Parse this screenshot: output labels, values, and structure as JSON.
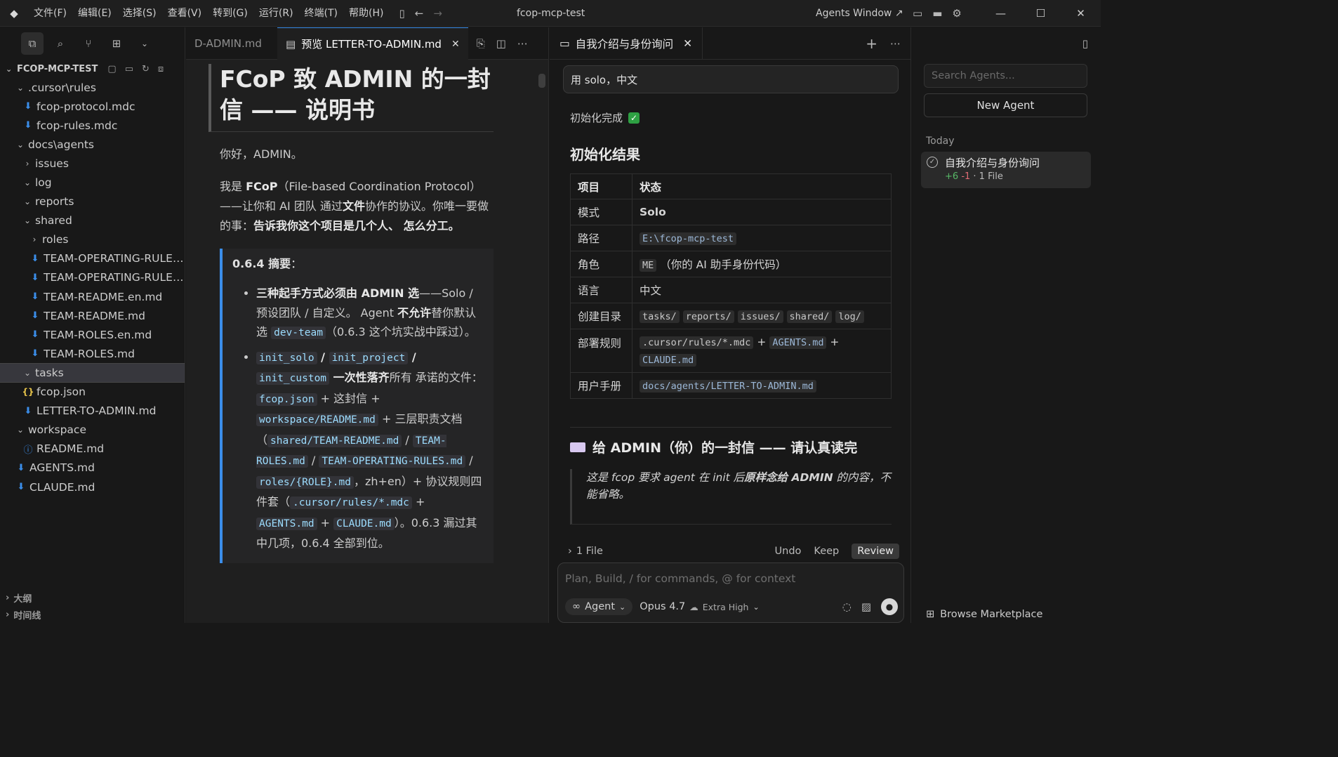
{
  "titlebar": {
    "menu": [
      "文件(F)",
      "编辑(E)",
      "选择(S)",
      "查看(V)",
      "转到(G)",
      "运行(R)",
      "终端(T)",
      "帮助(H)"
    ],
    "window_title": "fcop-mcp-test",
    "agents_window": "Agents Window ↗"
  },
  "sidebar": {
    "root": "FCOP-MCP-TEST",
    "tree": [
      {
        "label": ".cursor\\rules",
        "depth": 0,
        "kind": "folder-open"
      },
      {
        "label": "fcop-protocol.mdc",
        "depth": 1,
        "kind": "md"
      },
      {
        "label": "fcop-rules.mdc",
        "depth": 1,
        "kind": "md"
      },
      {
        "label": "docs\\agents",
        "depth": 0,
        "kind": "folder-open"
      },
      {
        "label": "issues",
        "depth": 1,
        "kind": "folder"
      },
      {
        "label": "log",
        "depth": 1,
        "kind": "folder-open"
      },
      {
        "label": "reports",
        "depth": 1,
        "kind": "folder-open"
      },
      {
        "label": "shared",
        "depth": 1,
        "kind": "folder-open"
      },
      {
        "label": "roles",
        "depth": 2,
        "kind": "folder"
      },
      {
        "label": "TEAM-OPERATING-RULES.en.md",
        "depth": 2,
        "kind": "md"
      },
      {
        "label": "TEAM-OPERATING-RULES.md",
        "depth": 2,
        "kind": "md"
      },
      {
        "label": "TEAM-README.en.md",
        "depth": 2,
        "kind": "md"
      },
      {
        "label": "TEAM-README.md",
        "depth": 2,
        "kind": "md"
      },
      {
        "label": "TEAM-ROLES.en.md",
        "depth": 2,
        "kind": "md"
      },
      {
        "label": "TEAM-ROLES.md",
        "depth": 2,
        "kind": "md"
      },
      {
        "label": "tasks",
        "depth": 1,
        "kind": "folder-open",
        "selected": true
      },
      {
        "label": "fcop.json",
        "depth": 1,
        "kind": "json"
      },
      {
        "label": "LETTER-TO-ADMIN.md",
        "depth": 1,
        "kind": "md"
      },
      {
        "label": "workspace",
        "depth": 0,
        "kind": "folder-open"
      },
      {
        "label": "README.md",
        "depth": 1,
        "kind": "info"
      },
      {
        "label": "AGENTS.md",
        "depth": 0,
        "kind": "md"
      },
      {
        "label": "CLAUDE.md",
        "depth": 0,
        "kind": "md"
      }
    ],
    "outline": "大纲",
    "timeline": "时间线"
  },
  "editor": {
    "tab_inactive": "D-ADMIN.md",
    "tab_active": "预览 LETTER-TO-ADMIN.md",
    "h1": "FCoP 致 ADMIN 的一封信 —— 说明书",
    "p1": "你好，ADMIN。",
    "p2_a": "我是 ",
    "p2_b": "FCoP",
    "p2_c": "（File-based Coordination Protocol）——让你和 AI 团队 通过",
    "p2_d": "文件",
    "p2_e": "协作的协议。你唯一要做的事：",
    "p2_f": "告诉我你这个项目是几个人、 怎么分工。",
    "summary_head": "0.6.4 摘要",
    "summary_colon": "：",
    "b1_a": "三种起手方式必须由 ADMIN 选",
    "b1_b": "——Solo / 预设团队 / 自定义。 Agent ",
    "b1_c": "不允许",
    "b1_d": "替你默认选 ",
    "b1_code": "dev-team",
    "b1_e": "（0.6.3 这个坑实战中踩过）。",
    "b2_c1": "init_solo",
    "b2_s1": " / ",
    "b2_c2": "init_project",
    "b2_s2": " / ",
    "b2_c3": "init_custom",
    "b2_bold": " 一次性落齐",
    "b2_t1": "所有 承诺的文件：",
    "b2_c4": "fcop.json",
    "b2_t2": " + 这封信 + ",
    "b2_c5": "workspace/README.md",
    "b2_t3": " + 三层职责文档（",
    "b2_c6": "shared/TEAM-README.md",
    "b2_s3": " / ",
    "b2_c7": "TEAM-ROLES.md",
    "b2_s4": " / ",
    "b2_c8": "TEAM-OPERATING-RULES.md",
    "b2_s5": " / ",
    "b2_c9": "roles/{ROLE}.md",
    "b2_t4": "，zh+en）+ 协议规则四件套（",
    "b2_c10": ".cursor/rules/*.mdc",
    "b2_t5": " + ",
    "b2_c11": "AGENTS.md",
    "b2_t6": " + ",
    "b2_c12": "CLAUDE.md",
    "b2_t7": "）。0.6.3 漏过其中几项，0.6.4 全部到位。"
  },
  "chat": {
    "tab": "自我介绍与身份询问",
    "user_msg": "用 solo，中文",
    "init_done": "初始化完成",
    "result_h": "初始化结果",
    "table_headers": [
      "项目",
      "状态"
    ],
    "rows": {
      "mode_k": "模式",
      "mode_v": "Solo",
      "path_k": "路径",
      "path_v": "E:\\fcop-mcp-test",
      "role_k": "角色",
      "role_code": "ME",
      "role_v": "（你的 AI 助手身份代码）",
      "lang_k": "语言",
      "lang_v": "中文",
      "dirs_k": "创建目录",
      "dirs": [
        "tasks/",
        "reports/",
        "issues/",
        "shared/",
        "log/"
      ],
      "rules_k": "部署规则",
      "rules_a": ".cursor/rules/*.mdc",
      "rules_plus": "+",
      "rules_b": "AGENTS.md",
      "rules_c": "CLAUDE.md",
      "manual_k": "用户手册",
      "manual_v": "docs/agents/LETTER-TO-ADMIN.md"
    },
    "letter_h": "给 ADMIN（你）的一封信 —— 请认真读完",
    "letter_q_a": "这是 fcop 要求 agent 在 init 后",
    "letter_q_b": "原样念给 ADMIN",
    "letter_q_c": " 的内容，不能省略。",
    "file_count": "1 File",
    "undo": "Undo",
    "keep": "Keep",
    "review": "Review",
    "composer_placeholder": "Plan, Build, / for commands, @ for context",
    "agent_mode": "Agent",
    "model": "Opus 4.7",
    "effort": "Extra High"
  },
  "agents": {
    "search_placeholder": "Search Agents...",
    "new_agent": "New Agent",
    "today": "Today",
    "item_title": "自我介绍与身份询问",
    "item_plus": "+6",
    "item_minus": "-1",
    "item_files": "· 1 File",
    "browse": "Browse Marketplace"
  }
}
